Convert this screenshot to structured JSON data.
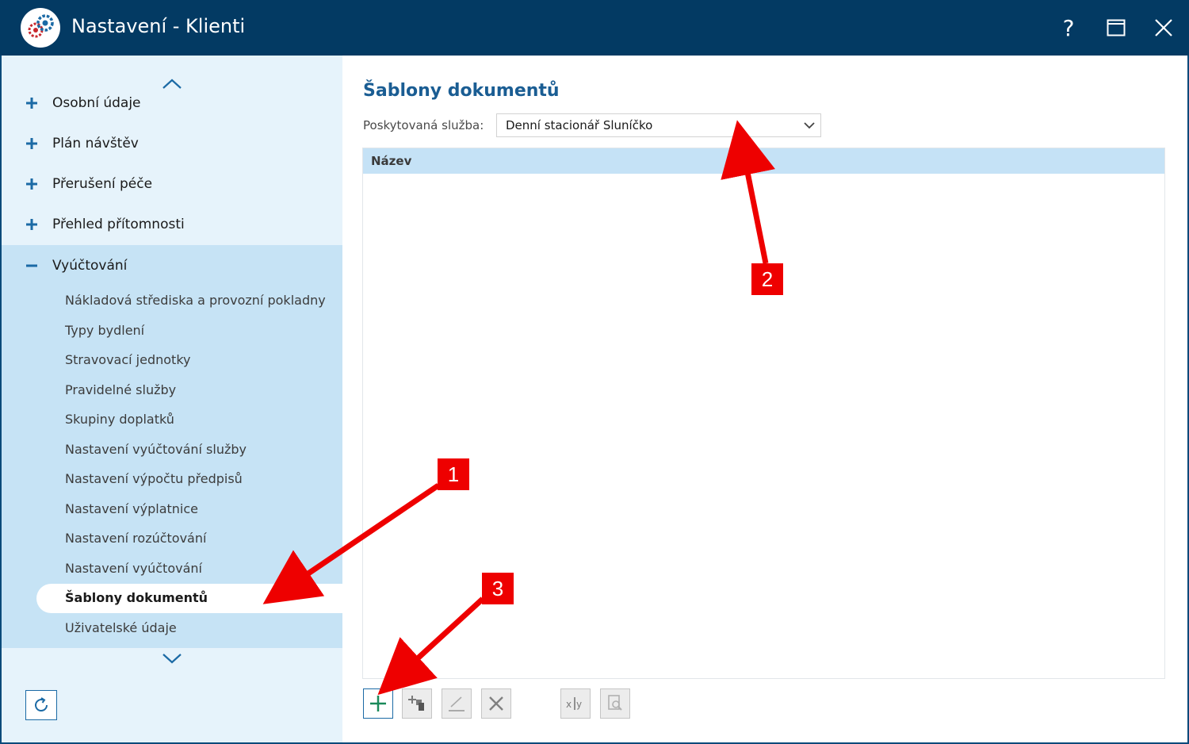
{
  "window": {
    "title": "Nastavení - Klienti",
    "help_label": "?"
  },
  "sidebar": {
    "items": [
      {
        "label": "Osobní údaje",
        "state": "collapsed"
      },
      {
        "label": "Plán návštěv",
        "state": "collapsed"
      },
      {
        "label": "Přerušení péče",
        "state": "collapsed"
      },
      {
        "label": "Přehled přítomnosti",
        "state": "collapsed"
      },
      {
        "label": "Vyúčtování",
        "state": "expanded"
      }
    ],
    "subitems": [
      "Nákladová střediska a provozní pokladny",
      "Typy bydlení",
      "Stravovací jednotky",
      "Pravidelné služby",
      "Skupiny doplatků",
      "Nastavení vyúčtování služby",
      "Nastavení výpočtu předpisů",
      "Nastavení výplatnice",
      "Nastavení rozúčtování",
      "Nastavení vyúčtování",
      "Šablony dokumentů",
      "Uživatelské údaje"
    ],
    "active_subitem": "Šablony dokumentů"
  },
  "main": {
    "title": "Šablony dokumentů",
    "service_label": "Poskytovaná služba:",
    "service_value": "Denní stacionář Sluníčko",
    "grid": {
      "columns": [
        "Název"
      ],
      "rows": []
    },
    "toolbar": [
      "add-icon",
      "copy-icon",
      "edit-icon",
      "delete-icon",
      "variables-icon",
      "preview-icon"
    ]
  },
  "annotations": [
    "1",
    "2",
    "3"
  ],
  "colors": {
    "titlebar": "#033a63",
    "sidebar_bg": "#e6f3fb",
    "group_bg": "#c6e3f5",
    "accent": "#1b6aa5",
    "title_text": "#1a5d93",
    "annotation_red": "#ee0000"
  }
}
